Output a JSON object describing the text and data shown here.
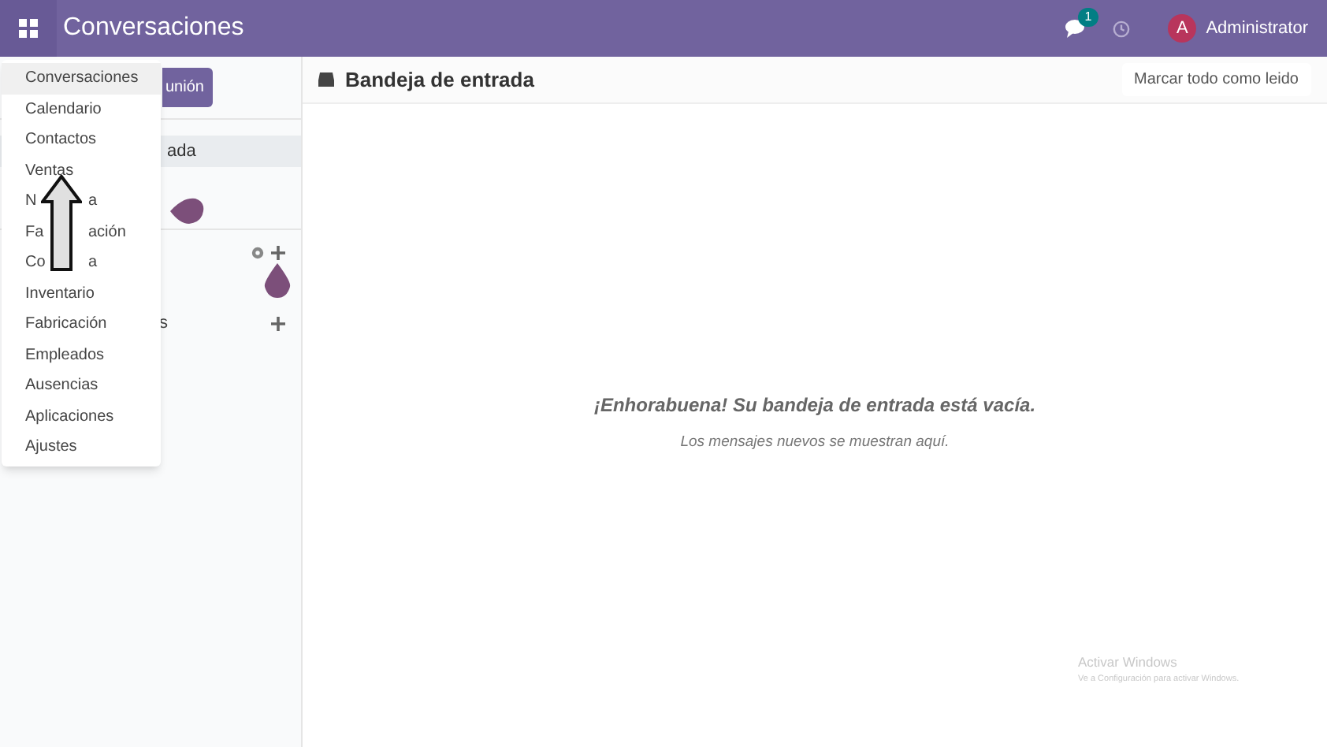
{
  "navbar": {
    "title": "Conversaciones",
    "message_count": "1",
    "user_initial": "A",
    "user_name": "Administrator"
  },
  "sidebar": {
    "button_fragment": "unión",
    "item_fragment": "ada",
    "channel_fragment": "s"
  },
  "app_menu": [
    {
      "label": "Conversaciones",
      "selected": true
    },
    {
      "label": "Calendario",
      "selected": false
    },
    {
      "label": "Contactos",
      "selected": false
    },
    {
      "label": "Ventas",
      "selected": false
    },
    {
      "label": "N",
      "label_end": "a",
      "selected": false
    },
    {
      "label": "Fa",
      "label_end": "ación",
      "selected": false
    },
    {
      "label": "Co",
      "label_end": "a",
      "selected": false
    },
    {
      "label": "Inventario",
      "selected": false
    },
    {
      "label": "Fabricación",
      "selected": false
    },
    {
      "label": "Empleados",
      "selected": false
    },
    {
      "label": "Ausencias",
      "selected": false
    },
    {
      "label": "Aplicaciones",
      "selected": false
    },
    {
      "label": "Ajustes",
      "selected": false
    }
  ],
  "main": {
    "title": "Bandeja de entrada",
    "mark_all_button": "Marcar todo como leido",
    "empty_title": "¡Enhorabuena! Su bandeja de entrada está vacía.",
    "empty_subtitle": "Los mensajes nuevos se muestran aquí."
  },
  "os_notice": {
    "title": "Activar Windows",
    "subtitle": "Ve a Configuración para activar Windows."
  }
}
